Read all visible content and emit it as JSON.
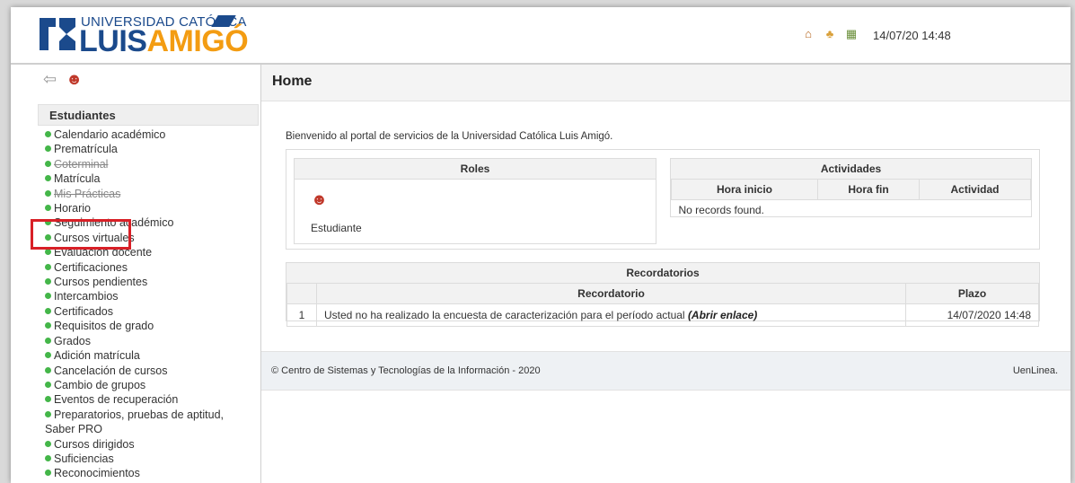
{
  "header": {
    "logo_top": "UNIVERSIDAD CATÓLICA",
    "logo_luis": "LUIS",
    "logo_amigo": "AMIGÓ",
    "datetime": "14/07/20 14:48",
    "icons": [
      "home-icon",
      "users-icon",
      "calendar-icon"
    ]
  },
  "sidebar": {
    "section_title": "Estudiantes",
    "items": [
      {
        "label": "Calendario académico"
      },
      {
        "label": "Prematrícula"
      },
      {
        "label": "Coterminal"
      },
      {
        "label": "Matrícula"
      },
      {
        "label": "Mis Prácticas"
      },
      {
        "label": "Horario"
      },
      {
        "label": "Seguimiento académico"
      },
      {
        "label": "Cursos virtuales"
      },
      {
        "label": "Evaluación docente"
      },
      {
        "label": "Certificaciones"
      },
      {
        "label": "Cursos pendientes"
      },
      {
        "label": "Intercambios"
      },
      {
        "label": "Certificados"
      },
      {
        "label": "Requisitos de grado"
      },
      {
        "label": "Grados"
      },
      {
        "label": "Adición matrícula"
      },
      {
        "label": "Cancelación de cursos"
      },
      {
        "label": "Cambio de grupos"
      },
      {
        "label": "Eventos de recuperación"
      },
      {
        "label": "Preparatorios, pruebas de aptitud, Saber PRO"
      },
      {
        "label": "Cursos dirigidos"
      },
      {
        "label": "Suficiencias"
      },
      {
        "label": "Reconocimientos"
      }
    ]
  },
  "main": {
    "title": "Home",
    "welcome": "Bienvenido al portal de servicios de la Universidad Católica Luis Amigó.",
    "roles": {
      "title": "Roles",
      "role": "Estudiante"
    },
    "activities": {
      "title": "Actividades",
      "columns": [
        "Hora inicio",
        "Hora fin",
        "Actividad"
      ],
      "empty": "No records found."
    },
    "reminders": {
      "title": "Recordatorios",
      "columns": [
        "Recordatorio",
        "Plazo"
      ],
      "rows": [
        {
          "num": "1",
          "text": "Usted no ha realizado la encuesta de caracterización para el período actual",
          "link": "(Abrir enlace)",
          "deadline": "14/07/2020 14:48"
        }
      ]
    }
  },
  "footer": {
    "left": "© Centro de Sistemas y Tecnologías de la Información - 2020",
    "right": "UenLinea."
  },
  "colors": {
    "brand_blue": "#1b4a8c",
    "brand_orange": "#f39c12",
    "highlight_red": "#d82027",
    "bullet_green": "#44b649"
  }
}
